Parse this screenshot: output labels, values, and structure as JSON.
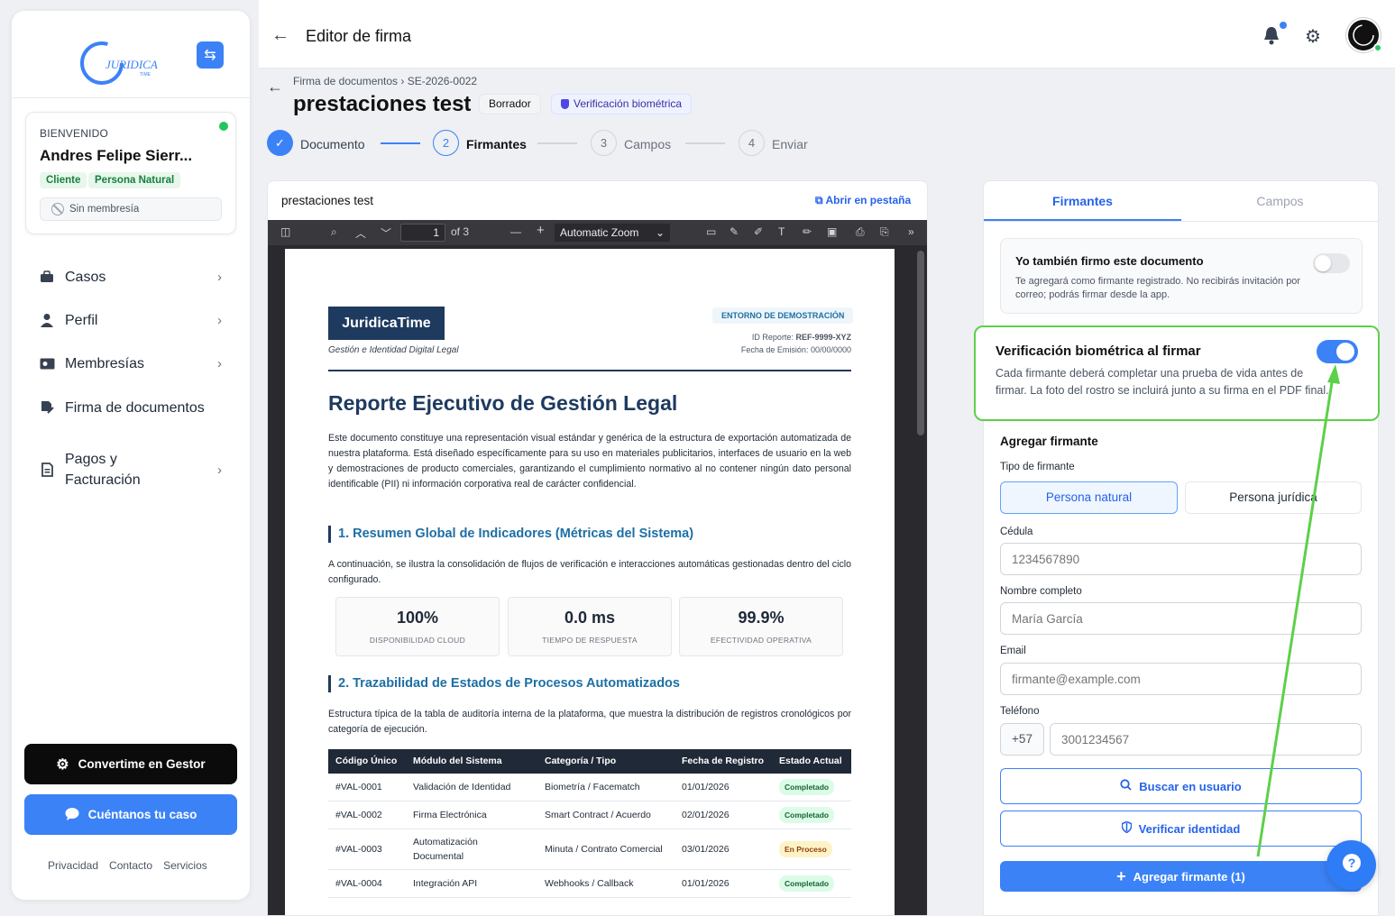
{
  "sidebar": {
    "logo_text": "JURIDICA",
    "logo_sub": "TIME",
    "welcome": "BIENVENIDO",
    "user_name": "Andres Felipe Sierr...",
    "tags": [
      "Cliente",
      "Persona Natural"
    ],
    "membership": "Sin membresía",
    "nav": [
      {
        "label": "Casos",
        "icon": "briefcase-icon"
      },
      {
        "label": "Perfil",
        "icon": "user-icon"
      },
      {
        "label": "Membresías",
        "icon": "id-card-icon"
      },
      {
        "label": "Firma de documentos",
        "icon": "signature-icon"
      },
      {
        "label": "Pagos y Facturación",
        "icon": "receipt-icon"
      }
    ],
    "btn_gestor": "Convertime en Gestor",
    "btn_caso": "Cuéntanos tu caso",
    "footer": [
      "Privacidad",
      "Contacto",
      "Servicios"
    ]
  },
  "header": {
    "title": "Editor de firma"
  },
  "document": {
    "breadcrumb": "Firma de documentos › SE-2026-0022",
    "title": "prestaciones test",
    "badge_status": "Borrador",
    "badge_bio": "Verificación biométrica",
    "steps": [
      {
        "num": "1",
        "label": "Documento",
        "state": "done"
      },
      {
        "num": "2",
        "label": "Firmantes",
        "state": "active"
      },
      {
        "num": "3",
        "label": "Campos",
        "state": "pending"
      },
      {
        "num": "4",
        "label": "Enviar",
        "state": "pending"
      }
    ]
  },
  "viewer": {
    "title": "prestaciones test",
    "open_tab": "Abrir en pestaña",
    "page_num": "1",
    "page_of": "of 3",
    "zoom": "Automatic Zoom"
  },
  "pdf": {
    "logo": "JuridicaTime",
    "logo_sub": "Gestión e Identidad Digital Legal",
    "env": "ENTORNO DE DEMOSTRACIÓN",
    "report_id_label": "ID Reporte:",
    "report_id": "REF-9999-XYZ",
    "emission": "Fecha de Emisión: 00/00/0000",
    "h1": "Reporte Ejecutivo de Gestión Legal",
    "intro": "Este documento constituye una representación visual estándar y genérica de la estructura de exportación automatizada de nuestra plataforma. Está diseñado específicamente para su uso en materiales publicitarios, interfaces de usuario en la web y demostraciones de producto comerciales, garantizando el cumplimiento normativo al no contener ningún dato personal identificable (PII) ni información corporativa real de carácter confidencial.",
    "h2a": "1. Resumen Global de Indicadores (Métricas del Sistema)",
    "p2": "A continuación, se ilustra la consolidación de flujos de verificación e interacciones automáticas gestionadas dentro del ciclo configurado.",
    "metrics": [
      {
        "value": "100%",
        "label": "DISPONIBILIDAD CLOUD"
      },
      {
        "value": "0.0 ms",
        "label": "TIEMPO DE RESPUESTA"
      },
      {
        "value": "99.9%",
        "label": "EFECTIVIDAD OPERATIVA"
      }
    ],
    "h2b": "2. Trazabilidad de Estados de Procesos Automatizados",
    "p3": "Estructura típica de la tabla de auditoría interna de la plataforma, que muestra la distribución de registros cronológicos por categoría de ejecución.",
    "table_headers": [
      "Código Único",
      "Módulo del Sistema",
      "Categoría / Tipo",
      "Fecha de Registro",
      "Estado Actual"
    ],
    "table_rows": [
      [
        "#VAL-0001",
        "Validación de Identidad",
        "Biometría / Facematch",
        "01/01/2026",
        "Completado"
      ],
      [
        "#VAL-0002",
        "Firma Electrónica",
        "Smart Contract / Acuerdo",
        "02/01/2026",
        "Completado"
      ],
      [
        "#VAL-0003",
        "Automatización Documental",
        "Minuta / Contrato Comercial",
        "03/01/2026",
        "En Proceso"
      ],
      [
        "#VAL-0004",
        "Integración API",
        "Webhooks / Callback",
        "01/01/2026",
        "Completado"
      ]
    ]
  },
  "panel": {
    "tabs": [
      "Firmantes",
      "Campos"
    ],
    "self_title": "Yo también firmo este documento",
    "self_desc": "Te agregará como firmante registrado. No recibirás invitación por correo; podrás firmar desde la app.",
    "bio_title": "Verificación biométrica al firmar",
    "bio_desc": "Cada firmante deberá completar una prueba de vida antes de firmar. La foto del rostro se incluirá junto a su firma en el PDF final.",
    "add_title": "Agregar firmante",
    "type_label": "Tipo de firmante",
    "type_options": [
      "Persona natural",
      "Persona jurídica"
    ],
    "cedula_label": "Cédula",
    "cedula_placeholder": "1234567890",
    "name_label": "Nombre completo",
    "name_placeholder": "María García",
    "email_label": "Email",
    "email_placeholder": "firmante@example.com",
    "phone_label": "Teléfono",
    "phone_prefix": "+57",
    "phone_placeholder": "3001234567",
    "btn_search": "Buscar en usuario",
    "btn_verify": "Verificar identidad",
    "btn_add": "Agregar firmante (1)"
  },
  "colors": {
    "accent": "#3b82f6",
    "highlight": "#5dd04a"
  }
}
